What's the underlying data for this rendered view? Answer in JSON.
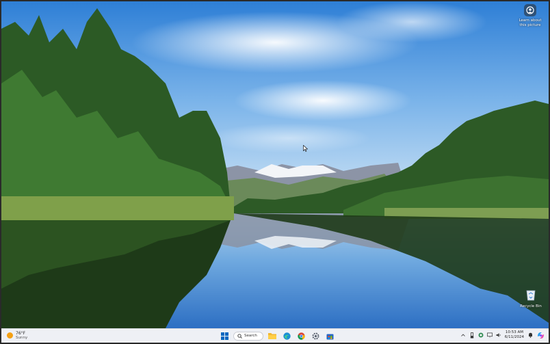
{
  "desktop": {
    "learn_line1": "Learn about",
    "learn_line2": "this picture",
    "recycle_label": "Recycle Bin"
  },
  "taskbar": {
    "weather": {
      "temp": "76°F",
      "condition": "Sunny"
    },
    "search_label": "Search",
    "apps": [
      "windows-start-icon",
      "search",
      "file-explorer-icon",
      "edge-icon",
      "chrome-icon",
      "settings-icon",
      "store-icon"
    ],
    "clock": {
      "time": "10:53 AM",
      "date": "6/11/2024"
    }
  },
  "colors": {
    "taskbar_bg": "#eef0f5",
    "accent": "#0067c0",
    "sun": "#f4a015"
  }
}
